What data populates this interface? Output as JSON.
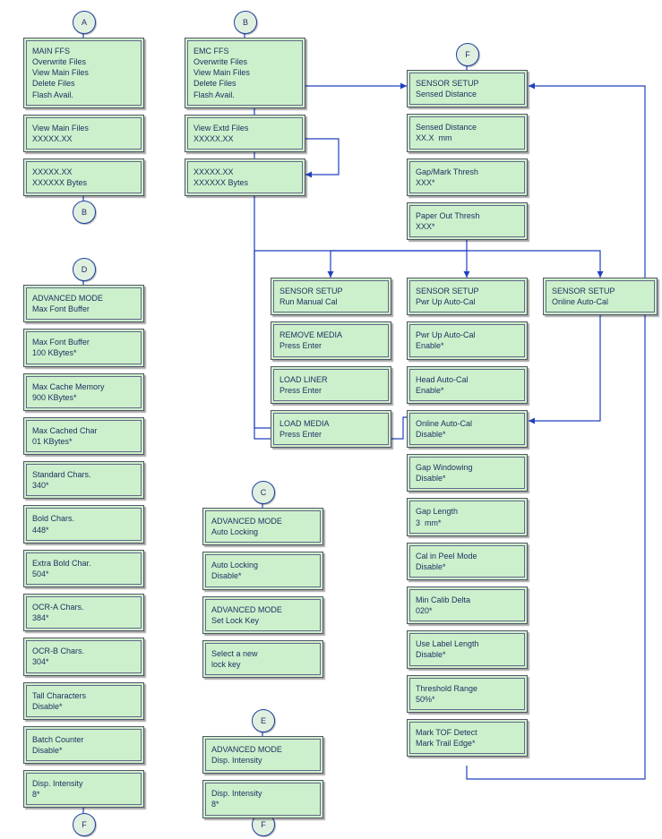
{
  "connectors": {
    "A": "A",
    "B": "B",
    "C": "C",
    "D": "D",
    "E": "E",
    "F": "F"
  },
  "colA": [
    {
      "lines": [
        "MAIN FFS",
        "Overwrite Files",
        "View Main Files",
        "Delete Files",
        "Flash Avail."
      ]
    },
    {
      "lines": [
        "View Main Files",
        "XXXXX.XX"
      ]
    },
    {
      "lines": [
        "XXXXX.XX",
        "XXXXXX Bytes"
      ]
    }
  ],
  "colB": [
    {
      "lines": [
        "EMC FFS",
        "Overwrite Files",
        "View Main Files",
        "Delete Files",
        "Flash Avail."
      ]
    },
    {
      "lines": [
        "View Extd Files",
        "XXXXX.XX"
      ]
    },
    {
      "lines": [
        "XXXXX.XX",
        "XXXXXX Bytes"
      ]
    }
  ],
  "colD": [
    {
      "lines": [
        "ADVANCED MODE",
        "Max Font Buffer"
      ]
    },
    {
      "lines": [
        "Max Font Buffer",
        "100 KBytes*"
      ]
    },
    {
      "lines": [
        "Max Cache Memory",
        "900 KBytes*"
      ]
    },
    {
      "lines": [
        "Max Cached Char",
        "01 KBytes*"
      ]
    },
    {
      "lines": [
        "Standard Chars.",
        "340*"
      ]
    },
    {
      "lines": [
        "Bold Chars.",
        "448*"
      ]
    },
    {
      "lines": [
        "Extra Bold Char.",
        "504*"
      ]
    },
    {
      "lines": [
        "OCR-A Chars.",
        "384*"
      ]
    },
    {
      "lines": [
        "OCR-B Chars.",
        "304*"
      ]
    },
    {
      "lines": [
        "Tall Characters",
        "Disable*"
      ]
    },
    {
      "lines": [
        "Batch Counter",
        "Disable*"
      ]
    },
    {
      "lines": [
        "Disp. Intensity",
        "8*"
      ]
    }
  ],
  "colC": [
    {
      "lines": [
        "ADVANCED MODE",
        "Auto Locking"
      ]
    },
    {
      "lines": [
        "Auto Locking",
        "Disable*"
      ]
    },
    {
      "lines": [
        "ADVANCED MODE",
        "Set Lock Key"
      ]
    },
    {
      "lines": [
        "Select a new",
        "lock key"
      ]
    }
  ],
  "colE": [
    {
      "lines": [
        "ADVANCED MODE",
        "Disp. Intensity"
      ]
    },
    {
      "lines": [
        "Disp. Intensity",
        "8*"
      ]
    }
  ],
  "colF": [
    {
      "lines": [
        "SENSOR SETUP",
        "Sensed Distance"
      ]
    },
    {
      "lines": [
        "Sensed Distance",
        "XX.X  mm"
      ]
    },
    {
      "lines": [
        "Gap/Mark Thresh",
        "XXX*"
      ]
    },
    {
      "lines": [
        "Paper Out Thresh",
        "XXX*"
      ]
    }
  ],
  "colG": [
    {
      "lines": [
        "SENSOR SETUP",
        "Run Manual Cal"
      ]
    },
    {
      "lines": [
        "REMOVE MEDIA",
        "Press Enter"
      ]
    },
    {
      "lines": [
        "LOAD LINER",
        "Press Enter"
      ]
    },
    {
      "lines": [
        "LOAD MEDIA",
        "Press Enter"
      ]
    }
  ],
  "colH": [
    {
      "lines": [
        "SENSOR SETUP",
        "Pwr Up Auto-Cal"
      ]
    },
    {
      "lines": [
        "Pwr Up Auto-Cal",
        "Enable*"
      ]
    },
    {
      "lines": [
        "Head Auto-Cal",
        "Enable*"
      ]
    },
    {
      "lines": [
        "Online Auto-Cal",
        "Disable*"
      ]
    },
    {
      "lines": [
        "Gap Windowing",
        "Disable*"
      ]
    },
    {
      "lines": [
        "Gap Length",
        "3  mm*"
      ]
    },
    {
      "lines": [
        "Cal in Peel Mode",
        "Disable*"
      ]
    },
    {
      "lines": [
        "Min Calib Delta",
        "020*"
      ]
    },
    {
      "lines": [
        "Use Label Length",
        "Disable*"
      ]
    },
    {
      "lines": [
        "Threshold Range",
        "50%*"
      ]
    },
    {
      "lines": [
        "Mark TOF Detect",
        "Mark Trail Edge*"
      ]
    }
  ],
  "colJ": [
    {
      "lines": [
        "SENSOR SETUP",
        "Online Auto-Cal"
      ]
    }
  ]
}
